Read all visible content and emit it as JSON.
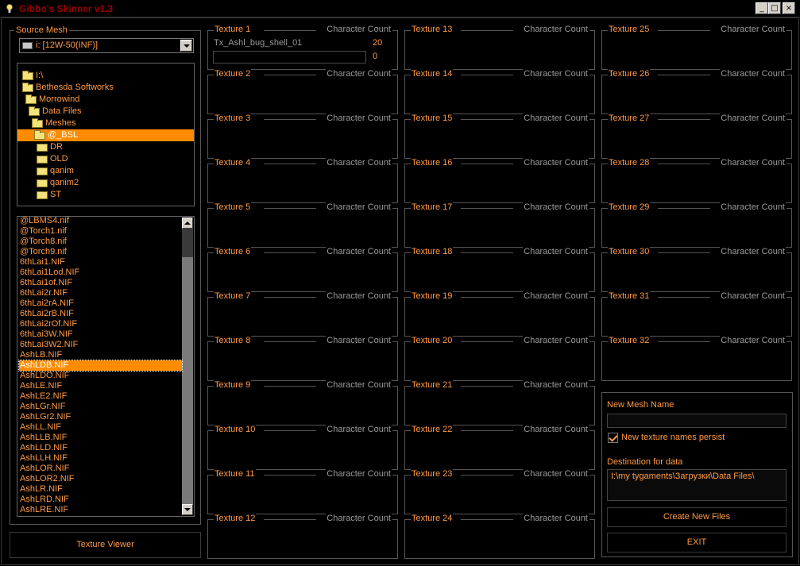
{
  "window": {
    "title": "Gibbo's Skinner v1.3",
    "controls": {
      "minimize": "_",
      "maximize": "□",
      "close": "×"
    }
  },
  "source_mesh": {
    "label": "Source Mesh",
    "drive": "i: [12W-50(INF)]",
    "folders": [
      {
        "name": "I:\\",
        "selected": false
      },
      {
        "name": "Bethesda Softworks",
        "selected": false
      },
      {
        "name": "Morrowind",
        "selected": false
      },
      {
        "name": "Data Files",
        "selected": false
      },
      {
        "name": "Meshes",
        "selected": false
      },
      {
        "name": "@_BSL",
        "selected": true
      },
      {
        "name": "DR",
        "selected": false
      },
      {
        "name": "OLD",
        "selected": false
      },
      {
        "name": "qanim",
        "selected": false
      },
      {
        "name": "qanim2",
        "selected": false
      },
      {
        "name": "ST",
        "selected": false
      }
    ],
    "files": [
      "@LBMS4.nif",
      "@Torch1.nif",
      "@Torch8.nif",
      "@Torch9.nif",
      "6thLai1.NIF",
      "6thLai1Lod.NIF",
      "6thLai1of.NIF",
      "6thLai2r.NIF",
      "6thLai2rA.NIF",
      "6thLai2rB.NIF",
      "6thLai2rOf.NIF",
      "6thLai3W.NIF",
      "6thLai3W2.NIF",
      "AshLB.NIF",
      "AshLDB.NIF",
      "AshLDO.NIF",
      "AshLE.NIF",
      "AshLE2.NIF",
      "AshLGr.NIF",
      "AshLGr2.NIF",
      "AshLL.NIF",
      "AshLLB.NIF",
      "AshLLD.NIF",
      "AshLLH.NIF",
      "AshLOR.NIF",
      "AshLOR2.NIF",
      "AshLR.NIF",
      "AshLRD.NIF",
      "AshLRE.NIF"
    ],
    "selected_file": "AshLDB.NIF"
  },
  "texture_viewer_label": "Texture Viewer",
  "character_count_label": "Character Count",
  "textures": [
    {
      "name": "Texture 1",
      "file": "Tx_Ashl_bug_shell_01",
      "count": "20",
      "new_count": "0"
    },
    {
      "name": "Texture 2"
    },
    {
      "name": "Texture 3"
    },
    {
      "name": "Texture 4"
    },
    {
      "name": "Texture 5"
    },
    {
      "name": "Texture 6"
    },
    {
      "name": "Texture 7"
    },
    {
      "name": "Texture 8"
    },
    {
      "name": "Texture 9"
    },
    {
      "name": "Texture 10"
    },
    {
      "name": "Texture 11"
    },
    {
      "name": "Texture 12"
    },
    {
      "name": "Texture 13"
    },
    {
      "name": "Texture 14"
    },
    {
      "name": "Texture 15"
    },
    {
      "name": "Texture 16"
    },
    {
      "name": "Texture 17"
    },
    {
      "name": "Texture 18"
    },
    {
      "name": "Texture 19"
    },
    {
      "name": "Texture 20"
    },
    {
      "name": "Texture 21"
    },
    {
      "name": "Texture 22"
    },
    {
      "name": "Texture 23"
    },
    {
      "name": "Texture 24"
    },
    {
      "name": "Texture 25"
    },
    {
      "name": "Texture 26"
    },
    {
      "name": "Texture 27"
    },
    {
      "name": "Texture 28"
    },
    {
      "name": "Texture 29"
    },
    {
      "name": "Texture 30"
    },
    {
      "name": "Texture 31"
    },
    {
      "name": "Texture 32"
    }
  ],
  "output": {
    "new_mesh_label": "New Mesh Name",
    "new_mesh_value": "",
    "persist_label": "New texture names persist",
    "persist_checked": true,
    "destination_label": "Destination for data",
    "destination_value": "I:\\my tygaments\\Загрузки\\Data Files\\",
    "create_button": "Create New Files",
    "exit_button": "EXIT"
  },
  "colors": {
    "text": "#ff9a45",
    "title": "#9a0000",
    "selection": "#ff8c00",
    "muted": "#9a9a9a",
    "background": "#000000"
  }
}
